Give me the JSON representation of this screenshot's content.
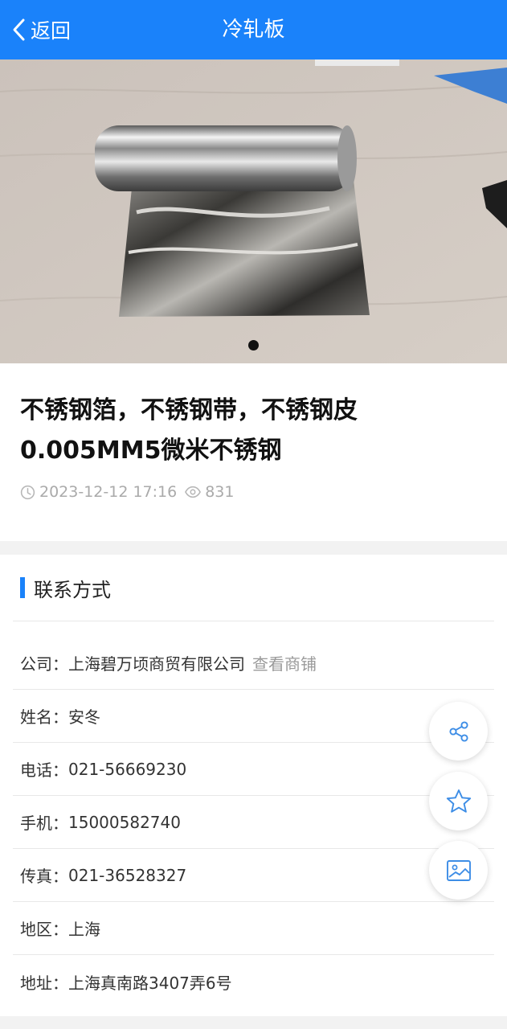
{
  "header": {
    "back_label": "返回",
    "title": "冷轧板"
  },
  "carousel": {
    "image_subject": "stainless steel foil roll",
    "dots": [
      {
        "active": true
      }
    ]
  },
  "product": {
    "title": "不锈钢箔，不锈钢带，不锈钢皮0.005MM5微米不锈钢",
    "date": "2023-12-12 17:16",
    "views": "831"
  },
  "contact": {
    "section_title": "联系方式",
    "company": {
      "key": "公司：",
      "value": "上海碧万顷商贸有限公司",
      "link": "查看商铺"
    },
    "name": {
      "key": "姓名：",
      "value": "安冬"
    },
    "phone": {
      "key": "电话：",
      "value": "021-56669230"
    },
    "mobile": {
      "key": "手机：",
      "value": "15000582740"
    },
    "fax": {
      "key": "传真：",
      "value": "021-36528327"
    },
    "region": {
      "key": "地区：",
      "value": "上海"
    },
    "address": {
      "key": "地址：",
      "value": "上海真南路3407弄6号"
    }
  },
  "fabs": {
    "share_icon": "share-icon",
    "favorite_icon": "star-icon",
    "gallery_icon": "image-icon"
  },
  "colors": {
    "accent": "#1a82fa",
    "muted": "#aaaaaa"
  }
}
